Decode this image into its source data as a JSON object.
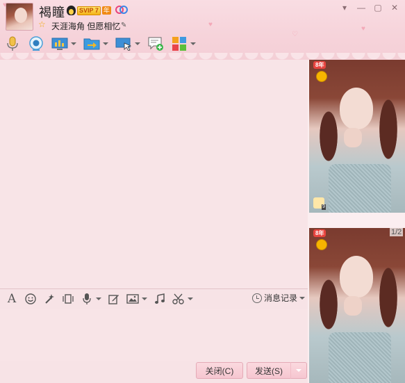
{
  "header": {
    "nickname": "褐瞳",
    "vip_label": "SVIP 7",
    "year_label": "年",
    "signature": "天涯海角 但愿相忆",
    "window_controls": [
      "minimize",
      "restore",
      "close"
    ]
  },
  "toolbar": {
    "items": [
      {
        "icon": "microphone-icon",
        "has_dropdown": false
      },
      {
        "icon": "webcam-icon",
        "has_dropdown": false
      },
      {
        "icon": "screen-share-icon",
        "has_dropdown": true
      },
      {
        "icon": "file-transfer-icon",
        "has_dropdown": true
      },
      {
        "icon": "remote-assist-icon",
        "has_dropdown": true
      },
      {
        "icon": "create-discussion-icon",
        "has_dropdown": false
      },
      {
        "icon": "apps-icon",
        "has_dropdown": true
      }
    ]
  },
  "input_toolbar": {
    "items": [
      "font-icon",
      "emoji-icon",
      "magic-icon",
      "screen-shake-icon",
      "voice-icon",
      "doodle-icon",
      "image-icon",
      "music-icon",
      "screenshot-icon"
    ],
    "message_record_label": "消息记录"
  },
  "buttons": {
    "close_label": "关闭(C)",
    "send_label": "发送(S)"
  },
  "right_pane": {
    "badge_label": "8年",
    "thumb_count": "9",
    "page_indicator": "1/2"
  },
  "colors": {
    "header_pink": "#f6d3da",
    "chat_bg": "#f8e4e7",
    "button_pink": "#f6c6d0"
  }
}
